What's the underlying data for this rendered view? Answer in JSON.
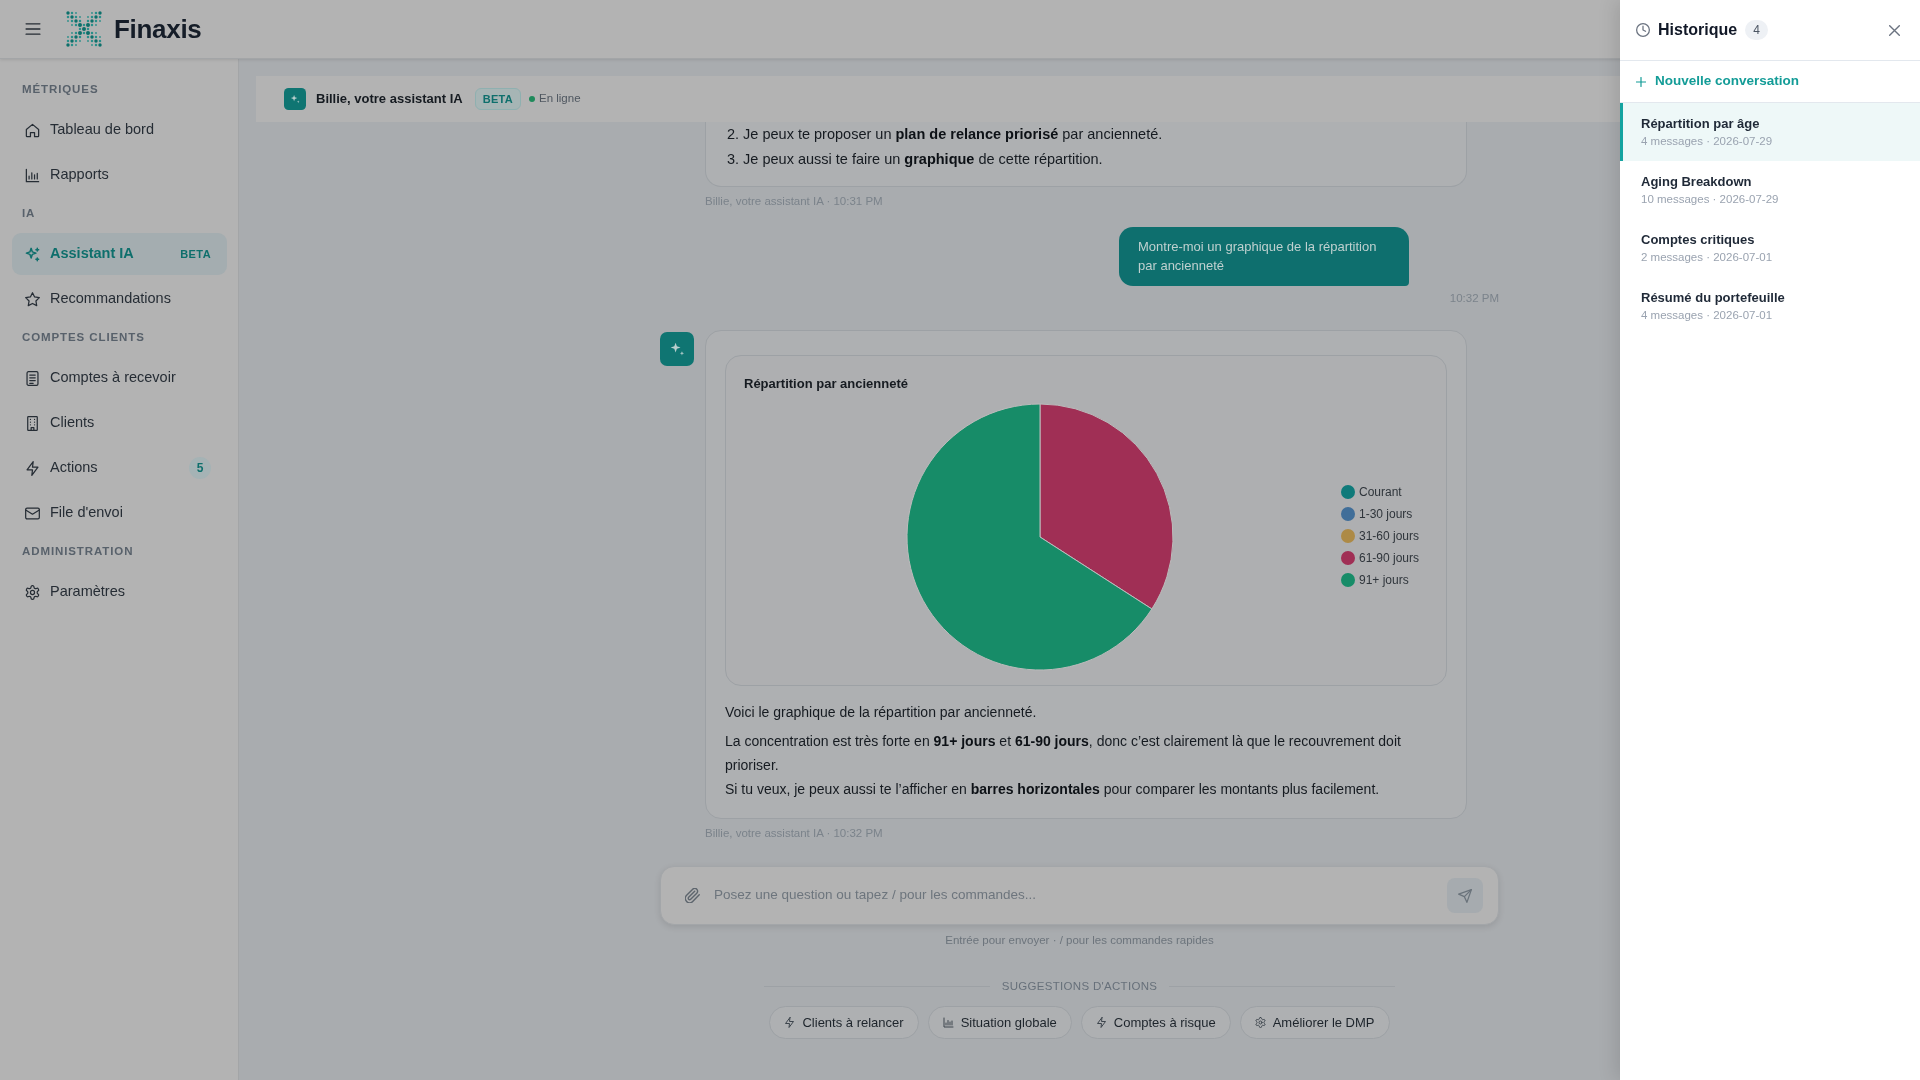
{
  "topbar": {
    "brand": "Finaxis"
  },
  "sidebar": {
    "sections": [
      {
        "label": "MÉTRIQUES",
        "items": [
          {
            "label": "Tableau de bord",
            "selected": false
          },
          {
            "label": "Rapports",
            "selected": false
          }
        ]
      },
      {
        "label": "IA",
        "items": [
          {
            "label": "Assistant IA",
            "selected": true,
            "badge": "BETA"
          },
          {
            "label": "Recommandations",
            "selected": false
          }
        ]
      },
      {
        "label": "COMPTES CLIENTS",
        "items": [
          {
            "label": "Comptes à recevoir",
            "selected": false
          },
          {
            "label": "Clients",
            "selected": false
          },
          {
            "label": "Actions",
            "selected": false,
            "count": "5"
          },
          {
            "label": "File d'envoi",
            "selected": false
          }
        ]
      },
      {
        "label": "ADMINISTRATION",
        "items": [
          {
            "label": "Paramètres",
            "selected": false
          }
        ]
      }
    ]
  },
  "chat_header": {
    "title": "Billie, votre assistant IA",
    "badge": "BETA",
    "status": "En ligne",
    "online": true
  },
  "messages": [
    {
      "kind": "assistant",
      "lines": [
        "2. Je peux te proposer un **plan de relance priorisé** par ancienneté.",
        "3. Je peux aussi te faire un **graphique** de cette répartition."
      ],
      "meta": "Billie, votre assistant IA · 10:31 PM"
    },
    {
      "kind": "user",
      "text": "Montre-moi un graphique de la répartition par ancienneté",
      "time": "10:32 PM"
    },
    {
      "kind": "assistant",
      "avatar": true,
      "chart_data": {
        "type": "pie",
        "title": "Répartition par ancienneté",
        "categories": [
          "Courant",
          "1-30 jours",
          "31-60 jours",
          "61-90 jours",
          "91+ jours"
        ],
        "values": [
          0,
          0,
          0,
          34.1,
          65.9
        ],
        "colors": [
          "#0f7a7a",
          "#406e99",
          "#ad8a46",
          "#a02f55",
          "#178c68"
        ],
        "legend": "right"
      },
      "paragraphs": [
        [
          "Voici le graphique de la répartition par ancienneté."
        ],
        [
          "La concentration est très forte en **91+ jours** et **61-90 jours**, donc c’est clairement là que le recouvrement doit prioriser.",
          "Si tu veux, je peux aussi te l’afficher en **barres horizontales** pour comparer les montants plus facilement."
        ]
      ],
      "meta": "Billie, votre assistant IA · 10:32 PM"
    }
  ],
  "composer": {
    "placeholder": "Posez une question ou tapez / pour les commandes...",
    "hint": "Entrée pour envoyer · / pour les commandes rapides"
  },
  "suggestions": {
    "heading": "SUGGESTIONS D'ACTIONS",
    "chips": [
      {
        "label": "Clients à relancer"
      },
      {
        "label": "Situation globale"
      },
      {
        "label": "Comptes à risque"
      },
      {
        "label": "Améliorer le DMP"
      }
    ]
  },
  "history": {
    "title": "Historique",
    "count": "4",
    "new_label": "Nouvelle conversation",
    "items": [
      {
        "title": "Répartition par âge",
        "meta": "4 messages · 2026-07-29",
        "selected": true
      },
      {
        "title": "Aging Breakdown",
        "meta": "10 messages · 2026-07-29",
        "selected": false
      },
      {
        "title": "Comptes critiques",
        "meta": "2 messages · 2026-07-01",
        "selected": false
      },
      {
        "title": "Résumé du portefeuille",
        "meta": "4 messages · 2026-07-01",
        "selected": false
      }
    ]
  }
}
